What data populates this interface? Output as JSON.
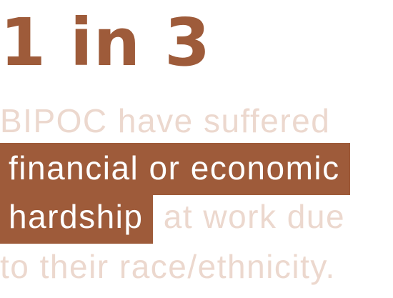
{
  "stat": "1 in 3",
  "lines": {
    "l1": "BIPOC have suffered",
    "l2_highlight": "financial or economic",
    "l3_highlight": "hardship",
    "l3_rest": " at work due",
    "l4": "to their race/ethnicity."
  },
  "colors": {
    "accent": "#9e5b3a",
    "muted_text": "#ecd8ce",
    "highlight_text": "#ffffff",
    "background": "#ffffff"
  }
}
